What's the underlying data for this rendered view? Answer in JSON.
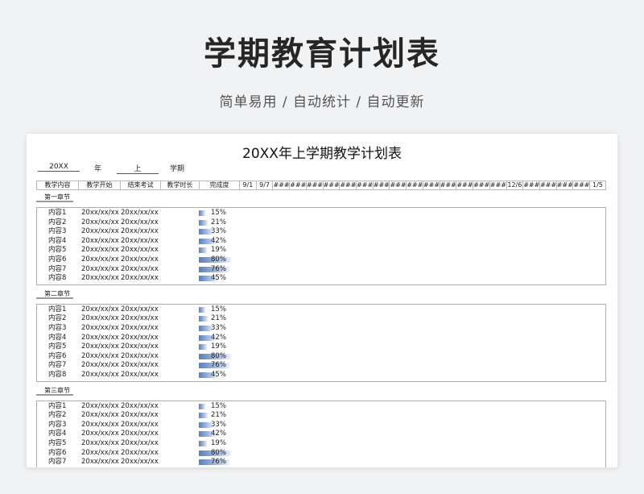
{
  "hero": {
    "title": "学期教育计划表",
    "subtitle": "简单易用 / 自动统计 / 自动更新"
  },
  "sheet": {
    "title": "20XX年上学期教学计划表",
    "meta": {
      "year_value": "20XX",
      "year_label": "年",
      "term_value": "上",
      "term_label": "学期"
    },
    "columns": [
      "教学内容",
      "教学开始",
      "结束考试",
      "教学时长",
      "完成度"
    ],
    "dates": [
      "9/1",
      "9/7",
      "###",
      "###",
      "###",
      "###",
      "###",
      "###",
      "###",
      "###",
      "###",
      "###",
      "###",
      "###",
      "###",
      "###",
      "12/6",
      "###",
      "###",
      "####",
      "###",
      "1/5"
    ],
    "chapters": [
      {
        "name": "第一章节",
        "rows": [
          {
            "content": "内容1",
            "start": "20xx/xx/xx",
            "end": "20xx/xx/xx",
            "completion": 15,
            "completion_label": "15%"
          },
          {
            "content": "内容2",
            "start": "20xx/xx/xx",
            "end": "20xx/xx/xx",
            "completion": 21,
            "completion_label": "21%"
          },
          {
            "content": "内容3",
            "start": "20xx/xx/xx",
            "end": "20xx/xx/xx",
            "completion": 33,
            "completion_label": "33%"
          },
          {
            "content": "内容4",
            "start": "20xx/xx/xx",
            "end": "20xx/xx/xx",
            "completion": 42,
            "completion_label": "42%"
          },
          {
            "content": "内容5",
            "start": "20xx/xx/xx",
            "end": "20xx/xx/xx",
            "completion": 19,
            "completion_label": "19%"
          },
          {
            "content": "内容6",
            "start": "20xx/xx/xx",
            "end": "20xx/xx/xx",
            "completion": 80,
            "completion_label": "80%"
          },
          {
            "content": "内容7",
            "start": "20xx/xx/xx",
            "end": "20xx/xx/xx",
            "completion": 76,
            "completion_label": "76%"
          },
          {
            "content": "内容8",
            "start": "20xx/xx/xx",
            "end": "20xx/xx/xx",
            "completion": 45,
            "completion_label": "45%"
          }
        ]
      },
      {
        "name": "第二章节",
        "rows": [
          {
            "content": "内容1",
            "start": "20xx/xx/xx",
            "end": "20xx/xx/xx",
            "completion": 15,
            "completion_label": "15%"
          },
          {
            "content": "内容2",
            "start": "20xx/xx/xx",
            "end": "20xx/xx/xx",
            "completion": 21,
            "completion_label": "21%"
          },
          {
            "content": "内容3",
            "start": "20xx/xx/xx",
            "end": "20xx/xx/xx",
            "completion": 33,
            "completion_label": "33%"
          },
          {
            "content": "内容4",
            "start": "20xx/xx/xx",
            "end": "20xx/xx/xx",
            "completion": 42,
            "completion_label": "42%"
          },
          {
            "content": "内容5",
            "start": "20xx/xx/xx",
            "end": "20xx/xx/xx",
            "completion": 19,
            "completion_label": "19%"
          },
          {
            "content": "内容6",
            "start": "20xx/xx/xx",
            "end": "20xx/xx/xx",
            "completion": 80,
            "completion_label": "80%"
          },
          {
            "content": "内容7",
            "start": "20xx/xx/xx",
            "end": "20xx/xx/xx",
            "completion": 76,
            "completion_label": "76%"
          },
          {
            "content": "内容8",
            "start": "20xx/xx/xx",
            "end": "20xx/xx/xx",
            "completion": 45,
            "completion_label": "45%"
          }
        ]
      },
      {
        "name": "第三章节",
        "rows": [
          {
            "content": "内容1",
            "start": "20xx/xx/xx",
            "end": "20xx/xx/xx",
            "completion": 15,
            "completion_label": "15%"
          },
          {
            "content": "内容2",
            "start": "20xx/xx/xx",
            "end": "20xx/xx/xx",
            "completion": 21,
            "completion_label": "21%"
          },
          {
            "content": "内容3",
            "start": "20xx/xx/xx",
            "end": "20xx/xx/xx",
            "completion": 33,
            "completion_label": "33%"
          },
          {
            "content": "内容4",
            "start": "20xx/xx/xx",
            "end": "20xx/xx/xx",
            "completion": 42,
            "completion_label": "42%"
          },
          {
            "content": "内容5",
            "start": "20xx/xx/xx",
            "end": "20xx/xx/xx",
            "completion": 19,
            "completion_label": "19%"
          },
          {
            "content": "内容6",
            "start": "20xx/xx/xx",
            "end": "20xx/xx/xx",
            "completion": 80,
            "completion_label": "80%"
          },
          {
            "content": "内容7",
            "start": "20xx/xx/xx",
            "end": "20xx/xx/xx",
            "completion": 76,
            "completion_label": "76%"
          }
        ]
      }
    ]
  },
  "colors": {
    "bar_start": "#5a7fb8",
    "bar_end": "#eef2f9",
    "background": "#f1f2f4"
  }
}
